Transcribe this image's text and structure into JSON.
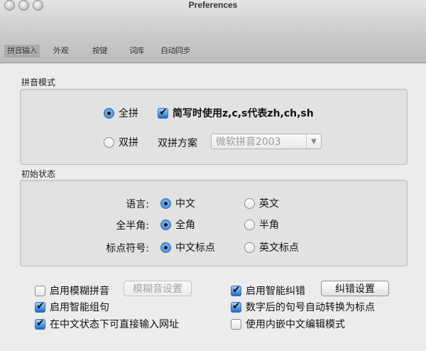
{
  "window": {
    "title": "Preferences"
  },
  "tabs": [
    {
      "label": "拼音输入"
    },
    {
      "label": "外观"
    },
    {
      "label": "按键"
    },
    {
      "label": "词库"
    },
    {
      "label": "自动同步"
    }
  ],
  "pinyin_mode": {
    "group_label": "拼音模式",
    "full_label": "全拼",
    "full_selected": true,
    "shorthand_label": "简写时使用z,c,s代表zh,ch,sh",
    "shorthand_checked": true,
    "double_label": "双拼",
    "double_selected": false,
    "scheme_label": "双拼方案",
    "scheme_value": "微软拼音2003"
  },
  "initial_state": {
    "group_label": "初始状态",
    "language_label": "语言:",
    "language_options": [
      "中文",
      "英文"
    ],
    "width_label": "全半角:",
    "width_options": [
      "全角",
      "半角"
    ],
    "punct_label": "标点符号:",
    "punct_options": [
      "中文标点",
      "英文标点"
    ]
  },
  "options": {
    "fuzzy_label": "启用模糊拼音",
    "fuzzy_checked": false,
    "fuzzy_settings_button": "模糊音设置",
    "smart_phrase_label": "启用智能组句",
    "smart_phrase_checked": true,
    "url_label": "在中文状态下可直接输入网址",
    "url_checked": true,
    "smart_correct_label": "启用智能纠错",
    "smart_correct_checked": true,
    "correct_settings_button": "纠错设置",
    "period_label": "数字后的句号自动转换为标点",
    "period_checked": true,
    "embed_label": "使用内嵌中文编辑模式",
    "embed_checked": false
  }
}
